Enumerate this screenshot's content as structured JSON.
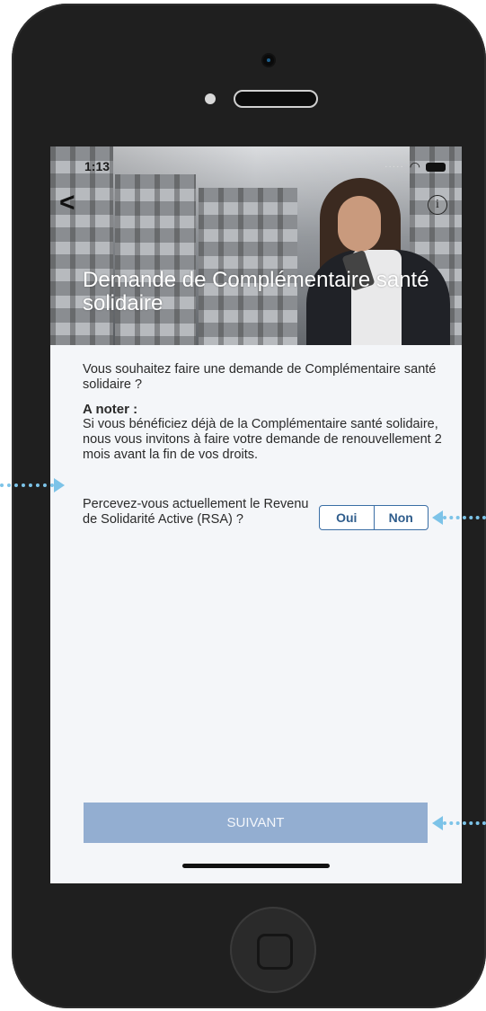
{
  "status_bar": {
    "time": "1:13"
  },
  "header": {
    "back_glyph": "<",
    "info_glyph": "i",
    "title": "Demande de Complémentaire santé solidaire"
  },
  "content": {
    "intro": "Vous souhaitez faire une demande de Complémentaire santé solidaire ?",
    "note_title": "A noter :",
    "note_body": "Si  vous bénéficiez déjà de la Complémentaire santé solidaire, nous vous invitons à faire votre demande de renouvellement 2 mois avant la fin de vos droits.",
    "question": "Percevez-vous actuellement le Revenu de Solidarité Active (RSA) ?",
    "toggle": {
      "yes": "Oui",
      "no": "Non"
    }
  },
  "footer": {
    "next_label": "SUIVANT"
  },
  "icons": [
    "back-chevron-icon",
    "info-icon",
    "wifi-icon",
    "battery-icon",
    "camera-icon",
    "home-button-icon",
    "annotation-arrow-icon"
  ],
  "colors": {
    "accent": "#3a6ea5",
    "button_disabled": "#93aed1",
    "annotation": "#7cc3e8",
    "phone_body": "#1f1f1f"
  }
}
